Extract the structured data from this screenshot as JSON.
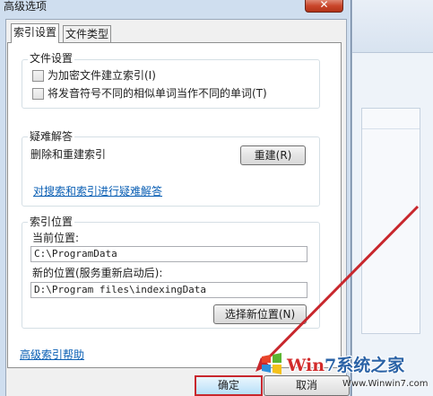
{
  "dialog": {
    "title": "高级选项",
    "close_glyph": "✕",
    "tabs": [
      {
        "label": "索引设置"
      },
      {
        "label": "文件类型"
      }
    ],
    "file_settings": {
      "group_label": "文件设置",
      "options": [
        {
          "label": "为加密文件建立索引(I)",
          "checked": false
        },
        {
          "label": "将发音符号不同的相似单词当作不同的单词(T)",
          "checked": false
        }
      ]
    },
    "troubleshoot": {
      "group_label": "疑难解答",
      "rebuild_text": "删除和重建索引",
      "rebuild_button": "重建(R)",
      "link": "对搜索和索引进行疑难解答"
    },
    "index_location": {
      "group_label": "索引位置",
      "current_label": "当前位置:",
      "current_value": "C:\\ProgramData",
      "new_label": "新的位置(服务重新启动后):",
      "new_value": "D:\\Program files\\indexingData",
      "select_button": "选择新位置(N)"
    },
    "help_link": "高级索引帮助",
    "ok_button": "确定",
    "cancel_button": "取消"
  },
  "watermark": {
    "brand_prefix": "Win",
    "brand_suffix": "7系统之家",
    "url": "Www.Winwin7.com"
  },
  "colors": {
    "annotation_red": "#c8272d",
    "link_blue": "#0a5fb4"
  }
}
